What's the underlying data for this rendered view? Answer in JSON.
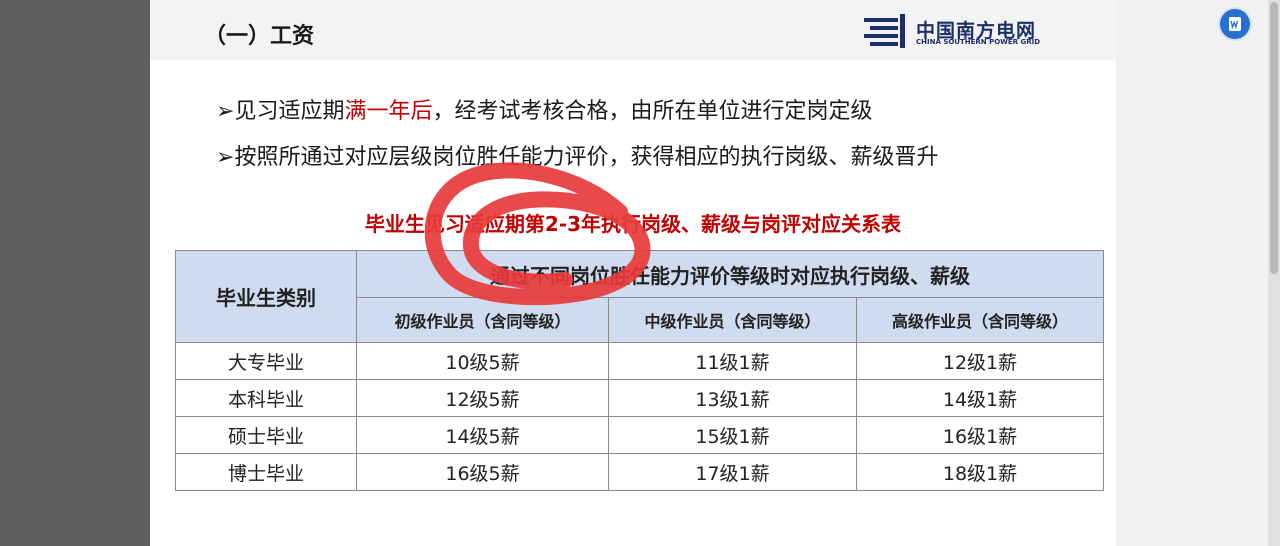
{
  "section_title": "（一）工资",
  "logo": {
    "name_cn": "中国南方电网",
    "name_en": "CHINA SOUTHERN POWER GRID"
  },
  "bullets": [
    {
      "marker": "➢",
      "before": "见习适应期",
      "highlight": "满一年后",
      "after": "，经考试考核合格，由所在单位进行定岗定级"
    },
    {
      "marker": "➢",
      "text": "按照所通过对应层级岗位胜任能力评价，获得相应的执行岗级、薪级晋升"
    }
  ],
  "table_title": "毕业生见习适应期第2-3年执行岗级、薪级与岗评对应关系表",
  "table": {
    "category_header": "毕业生类别",
    "group_header": "通过不同岗位胜任能力评价等级时对应执行岗级、薪级",
    "sub_headers": [
      "初级作业员（含同等级）",
      "中级作业员（含同等级）",
      "高级作业员（含同等级）"
    ],
    "rows": [
      {
        "category": "大专毕业",
        "values": [
          "10级5薪",
          "11级1薪",
          "12级1薪"
        ]
      },
      {
        "category": "本科毕业",
        "values": [
          "12级5薪",
          "13级1薪",
          "14级1薪"
        ]
      },
      {
        "category": "硕士毕业",
        "values": [
          "14级5薪",
          "15级1薪",
          "16级1薪"
        ]
      },
      {
        "category": "博士毕业",
        "values": [
          "16级5薪",
          "17级1薪",
          "18级1薪"
        ]
      }
    ]
  },
  "icons": {
    "word_app": "word-icon",
    "logo_mark": "power-grid-logo-icon"
  },
  "colors": {
    "highlight_red": "#c00000",
    "header_fill": "#cfdcef",
    "annotation_red": "#e83a3a",
    "logo_navy": "#1d2f6b"
  }
}
